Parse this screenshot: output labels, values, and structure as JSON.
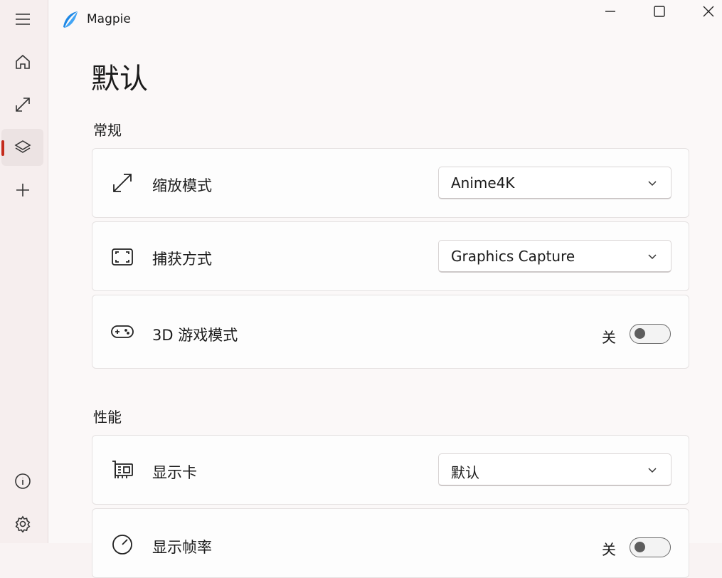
{
  "app": {
    "title": "Magpie"
  },
  "page": {
    "title": "默认"
  },
  "sections": {
    "general": {
      "title": "常规"
    },
    "performance": {
      "title": "性能"
    }
  },
  "settings": {
    "scaling_mode": {
      "label": "缩放模式",
      "value": "Anime4K",
      "icon": "resize-arrows-icon"
    },
    "capture_method": {
      "label": "捕获方式",
      "value": "Graphics Capture",
      "icon": "screen-capture-icon"
    },
    "game_mode_3d": {
      "label": "3D 游戏模式",
      "state_label": "关",
      "on": false,
      "icon": "gamepad-icon"
    },
    "graphics_card": {
      "label": "显示卡",
      "value": "默认",
      "icon": "graphics-card-icon"
    },
    "show_fps": {
      "label": "显示帧率",
      "state_label": "关",
      "on": false,
      "icon": "speedometer-icon"
    }
  },
  "nav": {
    "items": [
      {
        "name": "home",
        "icon": "home-icon"
      },
      {
        "name": "scaling",
        "icon": "resize-icon"
      },
      {
        "name": "profiles",
        "icon": "layers-icon",
        "selected": true
      },
      {
        "name": "add",
        "icon": "plus-icon"
      },
      {
        "name": "about",
        "icon": "info-icon"
      },
      {
        "name": "settings",
        "icon": "gear-icon"
      }
    ]
  },
  "colors": {
    "accent": "#c42b1c",
    "logo": "#1e88e5"
  }
}
